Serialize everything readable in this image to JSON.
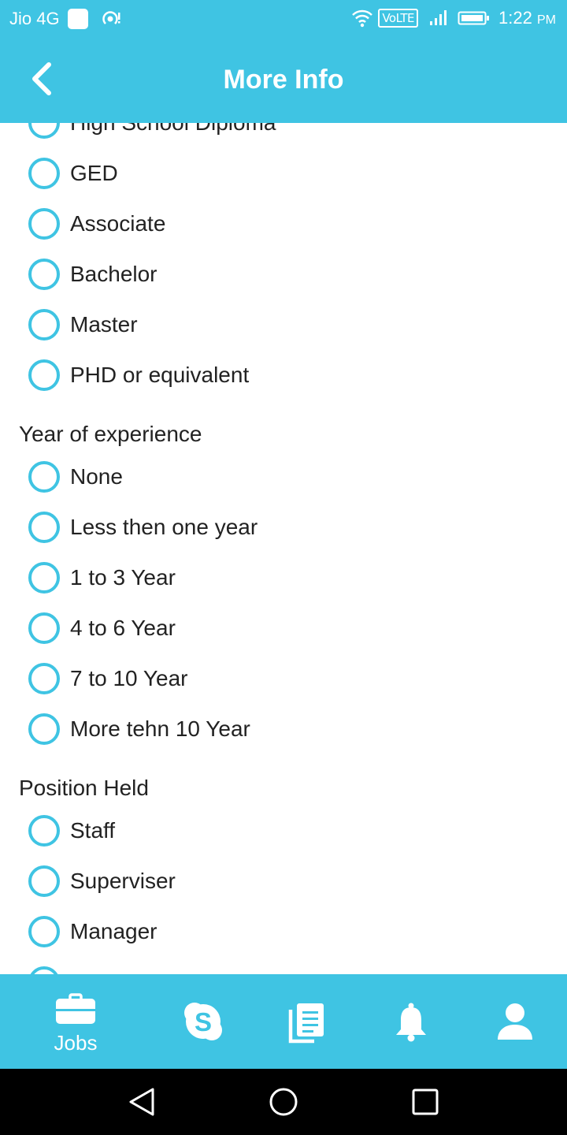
{
  "status_bar": {
    "carrier": "Jio 4G",
    "volte": "VoLTE",
    "time": "1:22",
    "ampm": "PM"
  },
  "app_bar": {
    "title": "More Info"
  },
  "education": {
    "cut_top_label": "High School Diploma",
    "options": [
      "GED",
      "Associate",
      "Bachelor",
      "Master",
      "PHD or equivalent"
    ]
  },
  "experience": {
    "title": "Year of experience",
    "options": [
      "None",
      "Less then one year",
      "1 to 3 Year",
      "4 to 6 Year",
      "7 to 10 Year",
      "More tehn 10 Year"
    ]
  },
  "position": {
    "title": "Position Held",
    "options": [
      "Staff",
      "Superviser",
      "Manager"
    ]
  },
  "bottom_nav": {
    "items": [
      {
        "icon": "briefcase-icon",
        "label": "Jobs"
      },
      {
        "icon": "skype-icon"
      },
      {
        "icon": "documents-icon"
      },
      {
        "icon": "bell-icon"
      },
      {
        "icon": "user-icon"
      }
    ]
  },
  "colors": {
    "accent": "#3fc4e3",
    "text": "#222222",
    "background": "#ffffff",
    "system_nav": "#000000"
  }
}
